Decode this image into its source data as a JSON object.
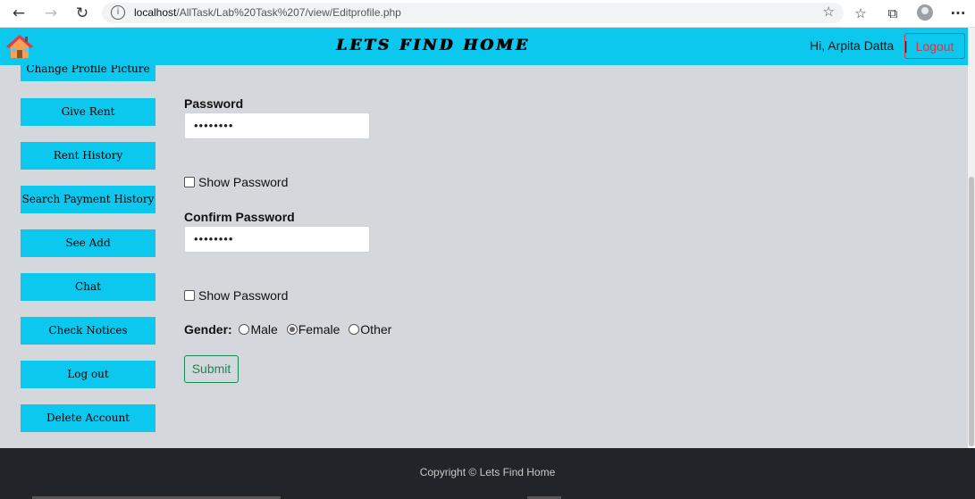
{
  "browser": {
    "url_host": "localhost",
    "url_path": "/AllTask/Lab%20Task%207/view/Editprofile.php",
    "back_icon": "←",
    "forward_icon": "→",
    "reload_icon": "↻",
    "info_icon": "i",
    "favorite_icon": "☆",
    "favorites_icon": "☆",
    "collections_icon": "⧉",
    "more_icon": "···"
  },
  "header": {
    "brand": "LETS FIND HOME",
    "greeting": "Hi, Arpita Datta",
    "separator": "|",
    "logout_label": "Logout"
  },
  "sidebar": {
    "items": [
      {
        "label": "Change Profile Picture"
      },
      {
        "label": "Give Rent"
      },
      {
        "label": "Rent History"
      },
      {
        "label": "Search Payment History"
      },
      {
        "label": "See Add"
      },
      {
        "label": "Chat"
      },
      {
        "label": "Check Notices"
      },
      {
        "label": "Log out"
      },
      {
        "label": "Delete Account"
      }
    ]
  },
  "form": {
    "password_label": "Password",
    "password_value": "••••••••",
    "show_password_label": "Show Password",
    "confirm_label": "Confirm Password",
    "confirm_value": "••••••••",
    "show_confirm_label": "Show Password",
    "gender_label": "Gender:",
    "gender_options": [
      "Male",
      "Female",
      "Other"
    ],
    "gender_selected": "Female",
    "submit_label": "Submit"
  },
  "footer": {
    "copyright": "Copyright © Lets Find Home"
  },
  "colors": {
    "accent": "#0cc7ee",
    "page_bg": "#d4d7dc",
    "footer_bg": "#212529",
    "danger": "#dc3545",
    "success": "#198754"
  }
}
